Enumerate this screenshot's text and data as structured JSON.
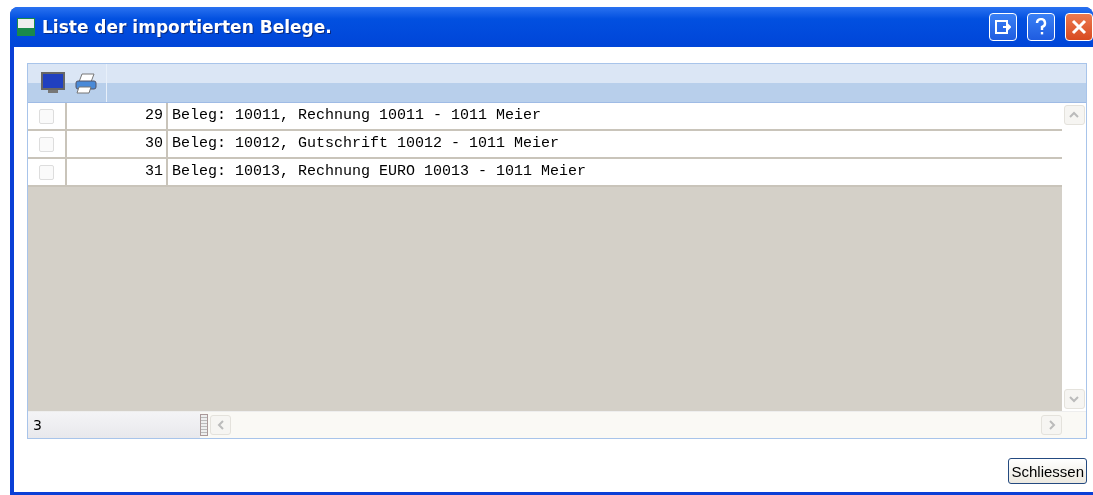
{
  "window": {
    "title": "Liste der importierten Belege."
  },
  "rows": [
    {
      "checked": false,
      "number": "29",
      "text": "Beleg: 10011, Rechnung 10011 - 1011 Meier"
    },
    {
      "checked": false,
      "number": "30",
      "text": "Beleg: 10012, Gutschrift 10012 - 1011 Meier"
    },
    {
      "checked": false,
      "number": "31",
      "text": "Beleg: 10013, Rechnung EURO 10013 - 1011 Meier"
    }
  ],
  "status": {
    "count": "3"
  },
  "buttons": [
    "Schliessen"
  ]
}
